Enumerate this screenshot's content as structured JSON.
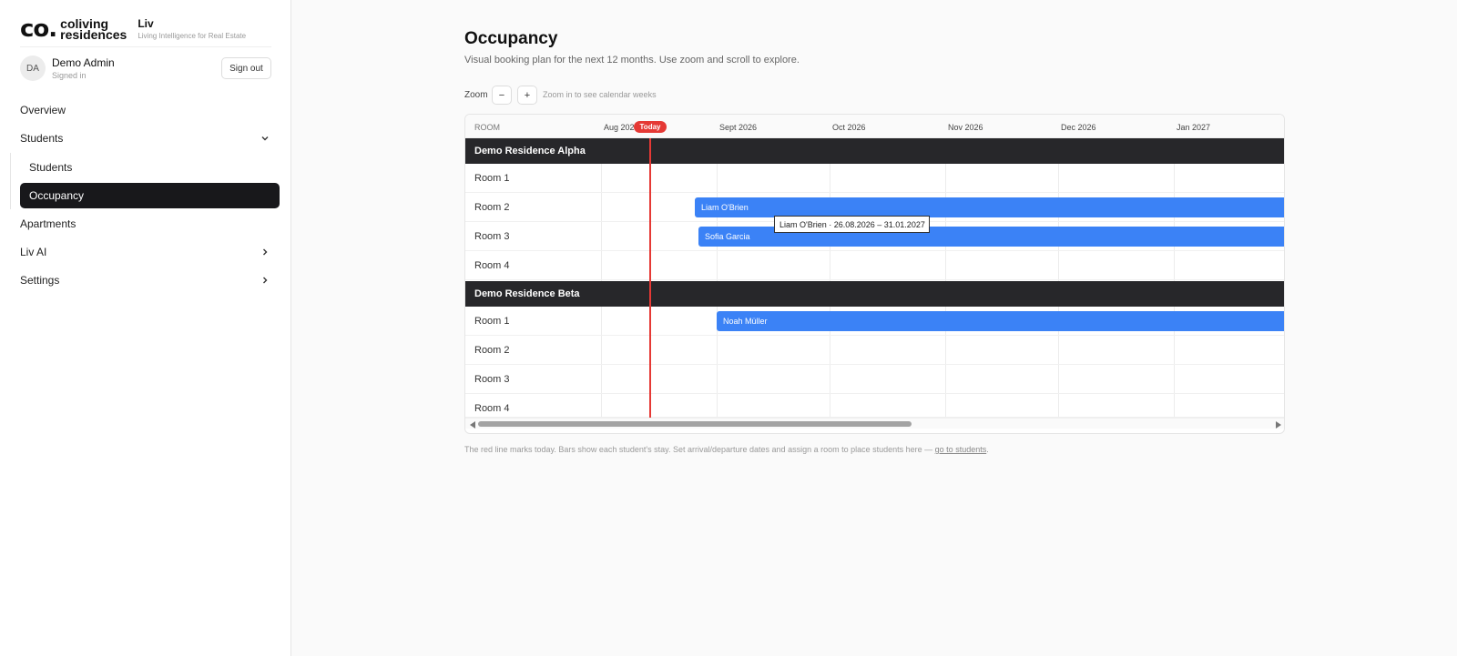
{
  "brand": {
    "logo_mark": "co.",
    "logo_line1": "coliving",
    "logo_line2": "residences",
    "app_name": "Liv",
    "tagline": "Living Intelligence for Real Estate"
  },
  "user": {
    "initials": "DA",
    "name": "Demo Admin",
    "status": "Signed in",
    "sign_out_label": "Sign out"
  },
  "nav": {
    "overview": "Overview",
    "students": "Students",
    "students_sub": "Students",
    "occupancy": "Occupancy",
    "apartments": "Apartments",
    "liv_ai": "Liv AI",
    "settings": "Settings"
  },
  "page": {
    "title": "Occupancy",
    "subtitle": "Visual booking plan for the next 12 months. Use zoom and scroll to explore."
  },
  "zoom": {
    "label": "Zoom",
    "minus": "−",
    "plus": "+",
    "hint": "Zoom in to see calendar weeks"
  },
  "grid": {
    "room_header": "ROOM",
    "months": [
      "Aug 2026",
      "Sept 2026",
      "Oct 2026",
      "Nov 2026",
      "Dec 2026",
      "Jan 2027"
    ],
    "today_label": "Today",
    "residences": [
      {
        "name": "Demo Residence Alpha",
        "rooms": [
          {
            "label": "Room 1"
          },
          {
            "label": "Room 2",
            "booking": "Liam O'Brien"
          },
          {
            "label": "Room 3",
            "booking": "Sofia Garcia"
          },
          {
            "label": "Room 4"
          }
        ]
      },
      {
        "name": "Demo Residence Beta",
        "rooms": [
          {
            "label": "Room 1",
            "booking": "Noah Müller"
          },
          {
            "label": "Room 2"
          },
          {
            "label": "Room 3"
          },
          {
            "label": "Room 4"
          }
        ]
      }
    ],
    "tooltip": "Liam O'Brien · 26.08.2026 – 31.01.2027"
  },
  "footnote": {
    "text": "The red line marks today. Bars show each student's stay. Set arrival/departure dates and assign a room to place students here —",
    "link": "go to students"
  },
  "colors": {
    "bar": "#3b82f6",
    "today": "#e53935",
    "residence_header": "#27272a",
    "active_nav": "#18181b"
  }
}
